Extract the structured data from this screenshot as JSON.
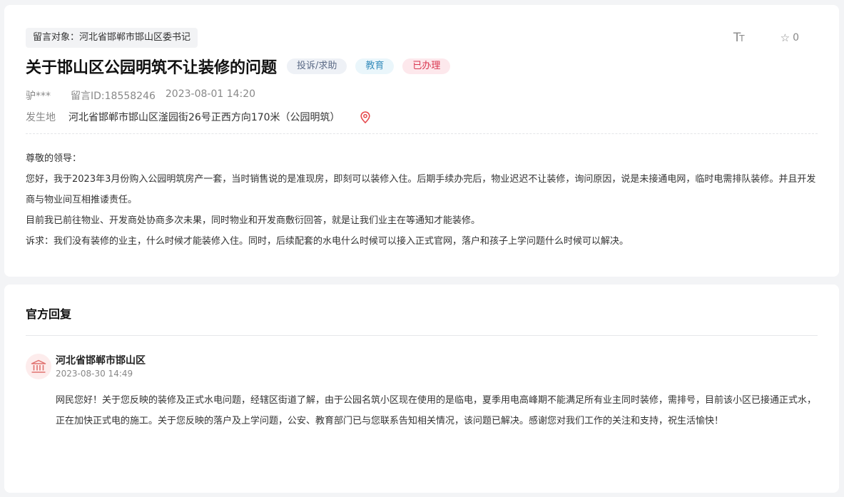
{
  "message": {
    "target": "留言对象：河北省邯郸市邯山区委书记",
    "title": "关于邯山区公园明筑不让装修的问题",
    "tags": {
      "type": "投诉/求助",
      "category": "教育",
      "status": "已办理"
    },
    "author": "驴***",
    "message_id": "留言ID:18558246",
    "date": "2023-08-01 14:20",
    "location_label": "发生地",
    "location": "河北省邯郸市邯山区滏园街26号正西方向170米（公园明筑）",
    "favorite_count": "0",
    "font_size_icon": "font-size-icon",
    "content": [
      "尊敬的领导：",
      "您好，我于2023年3月份购入公园明筑房产一套，当时销售说的是准现房，即刻可以装修入住。后期手续办完后，物业迟迟不让装修，询问原因，说是未接通电网，临时电需排队装修。并且开发商与物业间互相推诿责任。",
      "目前我已前往物业、开发商处协商多次未果，同时物业和开发商敷衍回答，就是让我们业主在等通知才能装修。",
      "诉求：我们没有装修的业主，什么时候才能装修入住。同时，后续配套的水电什么时候可以接入正式官网，落户和孩子上学问题什么时候可以解决。"
    ]
  },
  "reply": {
    "heading": "官方回复",
    "org": "河北省邯郸市邯山区",
    "time": "2023-08-30 14:49",
    "content": "网民您好！关于您反映的装修及正式水电问题，经辖区街道了解，由于公园名筑小区现在使用的是临电，夏季用电高峰期不能满足所有业主同时装修，需排号，目前该小区已接通正式水，正在加快正式电的施工。关于您反映的落户及上学问题，公安、教育部门已与您联系告知相关情况，该问题已解决。感谢您对我们工作的关注和支持，祝生活愉快！"
  },
  "colors": {
    "status_red": "#d9364f",
    "pin_red": "#e5484d",
    "gov_icon_red": "#e0716f"
  }
}
